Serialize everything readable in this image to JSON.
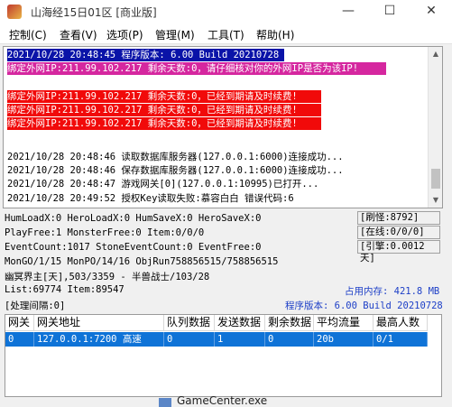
{
  "window": {
    "title": "山海经15日01区 [商业版]",
    "min_glyph": "—",
    "max_glyph": "☐",
    "close_glyph": "✕"
  },
  "menu": [
    "控制(C)",
    "查看(V)",
    "选项(P)",
    "管理(M)",
    "工具(T)",
    "帮助(H)"
  ],
  "log": [
    "2021/10/28 20:48:45 程序版本: 6.00 Build 20210728",
    "绑定外网IP:211.99.102.217 剩余天数:0，请仔细核对你的外网IP是否为该IP!",
    "绑定外网IP:211.99.102.217 剩余天数:0，已经到期请及时续费!",
    "绑定外网IP:211.99.102.217 剩余天数:0，已经到期请及时续费!",
    "绑定外网IP:211.99.102.217 剩余天数:0，已经到期请及时续费!",
    "2021/10/28 20:48:46 读取数据库服务器(127.0.0.1:6000)连接成功...",
    "2021/10/28 20:48:46 保存数据库服务器(127.0.0.1:6000)连接成功...",
    "2021/10/28 20:48:47 游戏网关[0](127.0.0.1:10995)已打开...",
    "2021/10/28 20:49:52 授权Key读取失败:慕容白白 错误代码:6"
  ],
  "stats": {
    "line1": "HumLoadX:0 HeroLoadX:0 HumSaveX:0 HeroSaveX:0",
    "line2": "PlayFree:1 MonsterFree:0 Item:0/0/0",
    "line3": "EventCount:1017 StoneEventCount:0 EventFree:0",
    "line4": "MonGO/1/15 MonPO/14/16 ObjRun758856515/758856515",
    "line5": "幽冥界主[天],503/3359 - 半兽战士/103/28",
    "line6": "List:69774 Item:89547",
    "line7": "[处理间隔:0]",
    "refresh": "[刷怪:8792]",
    "online": "[在线:0/0/0]",
    "engine": "[引擎:0.0012天]",
    "memory": "占用内存:  421.8 MB",
    "version": "程序版本: 6.00 Build 20210728"
  },
  "table": {
    "headers": [
      "网关",
      "网关地址",
      "队列数据",
      "发送数据",
      "剩余数据",
      "平均流量",
      "最高人数"
    ],
    "rows": [
      [
        "0",
        "127.0.0.1:7200 高速",
        "0",
        "1",
        "0",
        "20b",
        "0/1"
      ]
    ]
  },
  "taskbar": {
    "label": "GameCenter.exe"
  },
  "colors": {
    "selection": "#0f73d7",
    "alert_red": "#f10a0a",
    "alert_magenta": "#d5279f",
    "header_blue": "#0a13a8",
    "status_blue": "#1d3fc7"
  }
}
